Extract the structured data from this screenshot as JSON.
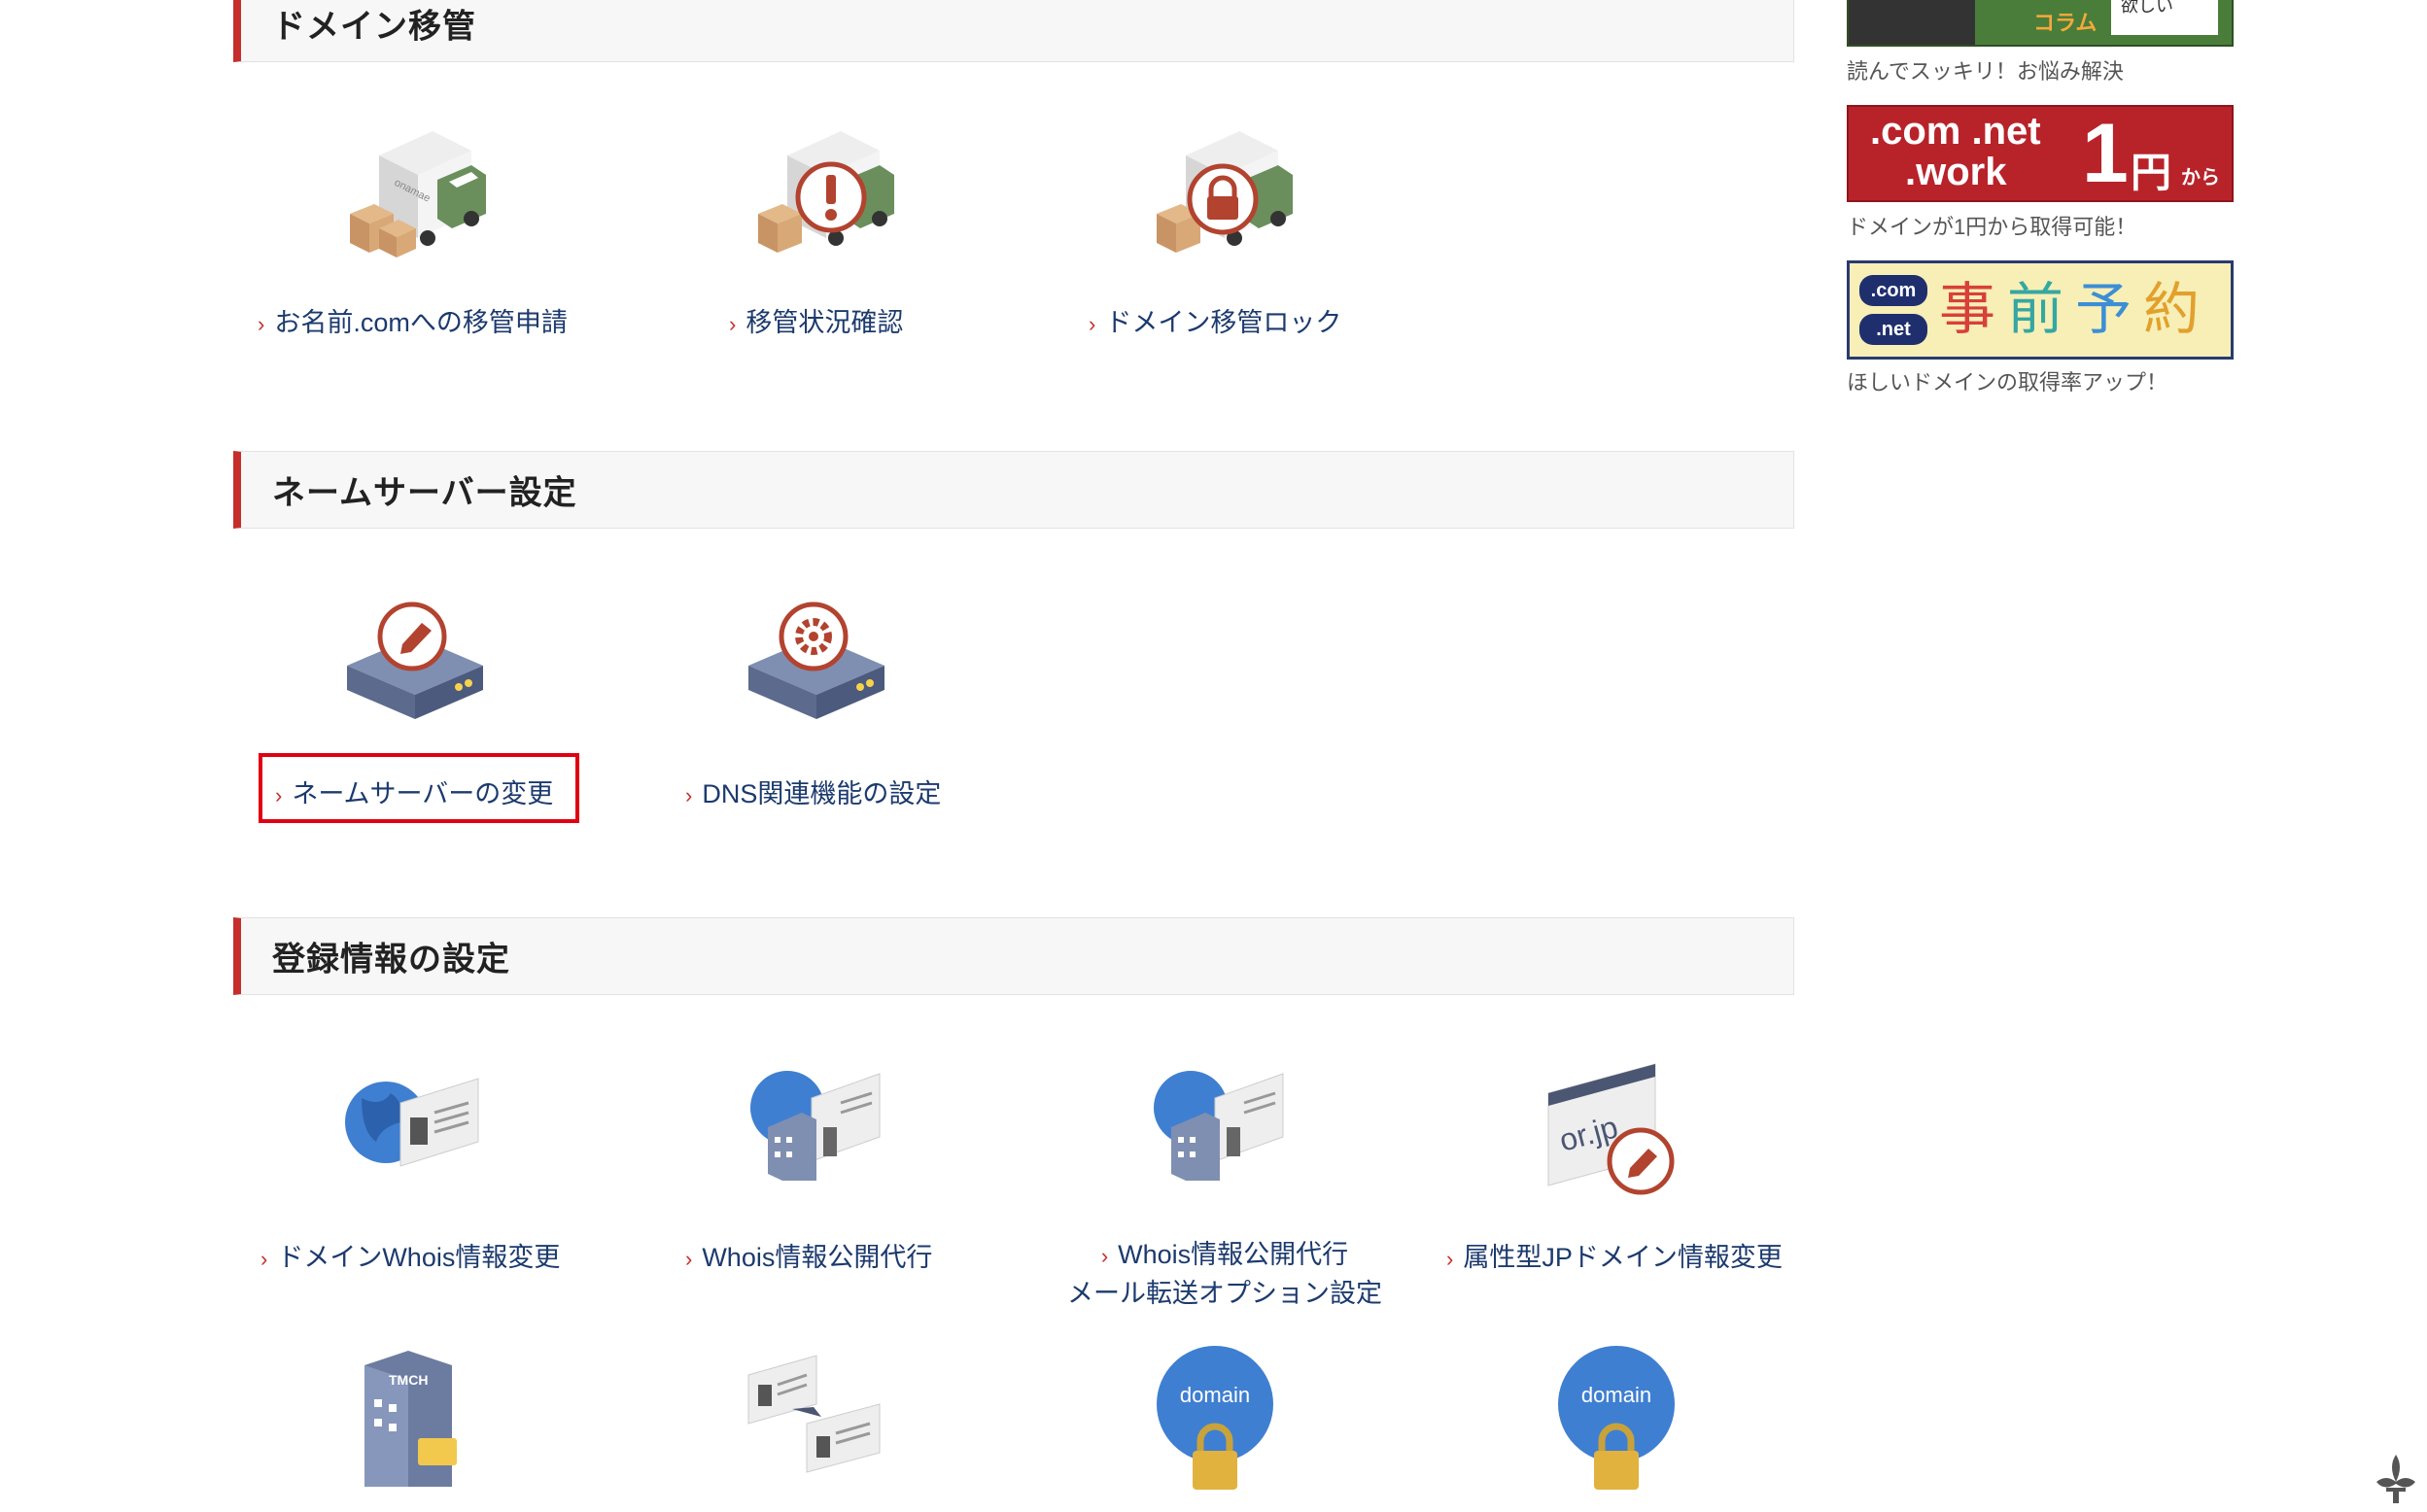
{
  "sections": [
    {
      "title": "ドメイン移管"
    },
    {
      "title": "ネームサーバー設定"
    },
    {
      "title": "登録情報の設定"
    }
  ],
  "transfer": {
    "items": [
      {
        "label": "お名前.comへの移管申請",
        "icon": "truck-boxes-icon"
      },
      {
        "label": "移管状況確認",
        "icon": "truck-alert-icon"
      },
      {
        "label": "ドメイン移管ロック",
        "icon": "truck-lock-icon"
      }
    ]
  },
  "nameserver": {
    "items": [
      {
        "label": "ネームサーバーの変更",
        "icon": "server-edit-icon"
      },
      {
        "label": "DNS関連機能の設定",
        "icon": "server-gear-icon"
      }
    ]
  },
  "registration": {
    "items": [
      {
        "label": "ドメインWhois情報変更",
        "icon": "globe-id-card-icon"
      },
      {
        "label": "Whois情報公開代行",
        "icon": "globe-building-icon"
      },
      {
        "label_line1": "Whois情報公開代行",
        "label_line2": "メール転送オプション設定",
        "icon": "globe-building-mail-icon"
      },
      {
        "label": "属性型JPドメイン情報変更",
        "icon": "jp-window-edit-icon",
        "icon_text": "or.jp"
      }
    ],
    "row2_icons": [
      {
        "icon": "tmch-building-icon",
        "icon_text": "TMCH"
      },
      {
        "icon": "id-cards-transfer-icon"
      },
      {
        "icon": "domain-lock-icon",
        "icon_text": "domain"
      },
      {
        "icon": "domain-lock-icon",
        "icon_text": "domain"
      }
    ]
  },
  "sidebar": {
    "banner1": {
      "caption": "読んでスッキリ！お悩み解決",
      "text1": "コラム",
      "text2": "欲しい"
    },
    "banner2": {
      "caption": "ドメインが1円から取得可能！",
      "line1": ".com .net",
      "line2": ".work",
      "big": "1",
      "yen": "円",
      "kara": "から"
    },
    "banner3": {
      "caption": "ほしいドメインの取得率アップ！",
      "com": ".com",
      "net": ".net",
      "chars": [
        "事",
        "前",
        "予",
        "約"
      ]
    }
  },
  "colors": {
    "accent": "#c62e2b",
    "link": "#1c3a6e",
    "highlight": "#e00012"
  }
}
